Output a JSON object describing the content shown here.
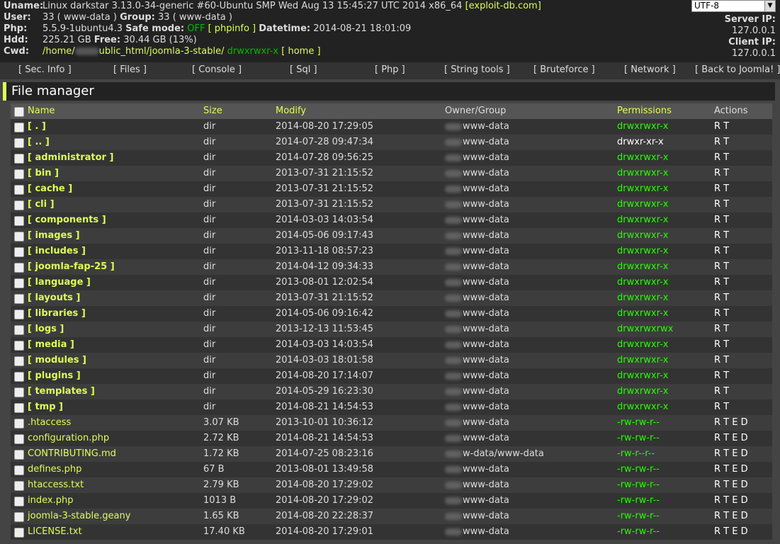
{
  "info": {
    "uname_label": "Uname:",
    "uname_value": "Linux darkstar 3.13.0-34-generic #60-Ubuntu SMP Wed Aug 13 15:45:27 UTC 2014 x86_64",
    "uname_link": "[exploit-db.com]",
    "user_label": "User:",
    "user_value": "33 ( www-data )",
    "group_label": "Group:",
    "group_value": "33 ( www-data )",
    "php_label": "Php:",
    "php_value": "5.5.9-1ubuntu4.3",
    "safe_mode_label": "Safe mode:",
    "safe_mode_value": "OFF",
    "phpinfo_link": "[ phpinfo ]",
    "datetime_label": "Datetime:",
    "datetime_value": "2014-08-21 18:01:09",
    "hdd_label": "Hdd:",
    "hdd_value": "225.21 GB",
    "free_label": "Free:",
    "free_value": "30.44 GB (13%)",
    "cwd_label": "Cwd:",
    "cwd_path_start": "/home/",
    "cwd_path_end": "ublic_html/joomla-3-stable/",
    "cwd_perms": "drwxrwxr-x",
    "cwd_home_link": "[ home ]"
  },
  "charset": {
    "selected": "UTF-8"
  },
  "server_ip_label": "Server IP:",
  "server_ip": "127.0.0.1",
  "client_ip_label": "Client IP:",
  "client_ip": "127.0.0.1",
  "menu": [
    "[ Sec. Info ]",
    "[ Files ]",
    "[ Console ]",
    "[ Sql ]",
    "[ Php ]",
    "[ String tools ]",
    "[ Bruteforce ]",
    "[ Network ]",
    "[ Back to Joomla! ]"
  ],
  "file_manager": {
    "title": "File manager",
    "headers": {
      "name": "Name",
      "size": "Size",
      "modify": "Modify",
      "owner": "Owner/Group",
      "permissions": "Permissions",
      "actions": "Actions"
    },
    "rows": [
      {
        "name": "[ . ]",
        "dir": true,
        "size": "dir",
        "modify": "2014-08-20 17:29:05",
        "owner": "www-data",
        "perms": "drwxrwxr-x",
        "writable": true,
        "actions": "R T"
      },
      {
        "name": "[ .. ]",
        "dir": true,
        "size": "dir",
        "modify": "2014-07-28 09:47:34",
        "owner": "www-data",
        "perms": "drwxr-xr-x",
        "writable": false,
        "actions": "R T"
      },
      {
        "name": "[ administrator ]",
        "dir": true,
        "size": "dir",
        "modify": "2014-07-28 09:56:25",
        "owner": "www-data",
        "perms": "drwxrwxr-x",
        "writable": true,
        "actions": "R T"
      },
      {
        "name": "[ bin ]",
        "dir": true,
        "size": "dir",
        "modify": "2013-07-31 21:15:52",
        "owner": "www-data",
        "perms": "drwxrwxr-x",
        "writable": true,
        "actions": "R T"
      },
      {
        "name": "[ cache ]",
        "dir": true,
        "size": "dir",
        "modify": "2013-07-31 21:15:52",
        "owner": "www-data",
        "perms": "drwxrwxr-x",
        "writable": true,
        "actions": "R T"
      },
      {
        "name": "[ cli ]",
        "dir": true,
        "size": "dir",
        "modify": "2013-07-31 21:15:52",
        "owner": "www-data",
        "perms": "drwxrwxr-x",
        "writable": true,
        "actions": "R T"
      },
      {
        "name": "[ components ]",
        "dir": true,
        "size": "dir",
        "modify": "2014-03-03 14:03:54",
        "owner": "www-data",
        "perms": "drwxrwxr-x",
        "writable": true,
        "actions": "R T"
      },
      {
        "name": "[ images ]",
        "dir": true,
        "size": "dir",
        "modify": "2014-05-06 09:17:43",
        "owner": "www-data",
        "perms": "drwxrwxr-x",
        "writable": true,
        "actions": "R T"
      },
      {
        "name": "[ includes ]",
        "dir": true,
        "size": "dir",
        "modify": "2013-11-18 08:57:23",
        "owner": "www-data",
        "perms": "drwxrwxr-x",
        "writable": true,
        "actions": "R T"
      },
      {
        "name": "[ joomla-fap-25 ]",
        "dir": true,
        "size": "dir",
        "modify": "2014-04-12 09:34:33",
        "owner": "www-data",
        "perms": "drwxrwxr-x",
        "writable": true,
        "actions": "R T"
      },
      {
        "name": "[ language ]",
        "dir": true,
        "size": "dir",
        "modify": "2013-08-01 12:02:54",
        "owner": "www-data",
        "perms": "drwxrwxr-x",
        "writable": true,
        "actions": "R T"
      },
      {
        "name": "[ layouts ]",
        "dir": true,
        "size": "dir",
        "modify": "2013-07-31 21:15:52",
        "owner": "www-data",
        "perms": "drwxrwxr-x",
        "writable": true,
        "actions": "R T"
      },
      {
        "name": "[ libraries ]",
        "dir": true,
        "size": "dir",
        "modify": "2014-05-06 09:16:42",
        "owner": "www-data",
        "perms": "drwxrwxr-x",
        "writable": true,
        "actions": "R T"
      },
      {
        "name": "[ logs ]",
        "dir": true,
        "size": "dir",
        "modify": "2013-12-13 11:53:45",
        "owner": "www-data",
        "perms": "drwxrwxrwx",
        "writable": true,
        "actions": "R T"
      },
      {
        "name": "[ media ]",
        "dir": true,
        "size": "dir",
        "modify": "2014-03-03 14:03:54",
        "owner": "www-data",
        "perms": "drwxrwxr-x",
        "writable": true,
        "actions": "R T"
      },
      {
        "name": "[ modules ]",
        "dir": true,
        "size": "dir",
        "modify": "2014-03-03 18:01:58",
        "owner": "www-data",
        "perms": "drwxrwxr-x",
        "writable": true,
        "actions": "R T"
      },
      {
        "name": "[ plugins ]",
        "dir": true,
        "size": "dir",
        "modify": "2014-08-20 17:14:07",
        "owner": "www-data",
        "perms": "drwxrwxr-x",
        "writable": true,
        "actions": "R T"
      },
      {
        "name": "[ templates ]",
        "dir": true,
        "size": "dir",
        "modify": "2014-05-29 16:23:30",
        "owner": "www-data",
        "perms": "drwxrwxr-x",
        "writable": true,
        "actions": "R T"
      },
      {
        "name": "[ tmp ]",
        "dir": true,
        "size": "dir",
        "modify": "2014-08-21 14:54:53",
        "owner": "www-data",
        "perms": "drwxrwxr-x",
        "writable": true,
        "actions": "R T"
      },
      {
        "name": ".htaccess",
        "dir": false,
        "size": "3.07 KB",
        "modify": "2013-10-01 10:36:12",
        "owner": "www-data",
        "perms": "-rw-rw-r--",
        "writable": true,
        "actions": "R T E D"
      },
      {
        "name": "configuration.php",
        "dir": false,
        "size": "2.72 KB",
        "modify": "2014-08-21 14:54:53",
        "owner": "www-data",
        "perms": "-rw-rw-r--",
        "writable": true,
        "actions": "R T E D"
      },
      {
        "name": "CONTRIBUTING.md",
        "dir": false,
        "size": "1.72 KB",
        "modify": "2014-07-25 08:23:16",
        "owner": "w-data/www-data",
        "perms": "-rw-r--r--",
        "writable": true,
        "actions": "R T E D"
      },
      {
        "name": "defines.php",
        "dir": false,
        "size": "67 B",
        "modify": "2013-08-01 13:49:58",
        "owner": "www-data",
        "perms": "-rw-rw-r--",
        "writable": true,
        "actions": "R T E D"
      },
      {
        "name": "htaccess.txt",
        "dir": false,
        "size": "2.79 KB",
        "modify": "2014-08-20 17:29:02",
        "owner": "www-data",
        "perms": "-rw-rw-r--",
        "writable": true,
        "actions": "R T E D"
      },
      {
        "name": "index.php",
        "dir": false,
        "size": "1013 B",
        "modify": "2014-08-20 17:29:02",
        "owner": "www-data",
        "perms": "-rw-rw-r--",
        "writable": true,
        "actions": "R T E D"
      },
      {
        "name": "joomla-3-stable.geany",
        "dir": false,
        "size": "1.65 KB",
        "modify": "2014-08-20 22:28:37",
        "owner": "www-data",
        "perms": "-rw-rw-r--",
        "writable": true,
        "actions": "R T E D"
      },
      {
        "name": "LICENSE.txt",
        "dir": false,
        "size": "17.40 KB",
        "modify": "2014-08-20 17:29:01",
        "owner": "www-data",
        "perms": "-rw-rw-r--",
        "writable": true,
        "actions": "R T E D"
      }
    ]
  }
}
